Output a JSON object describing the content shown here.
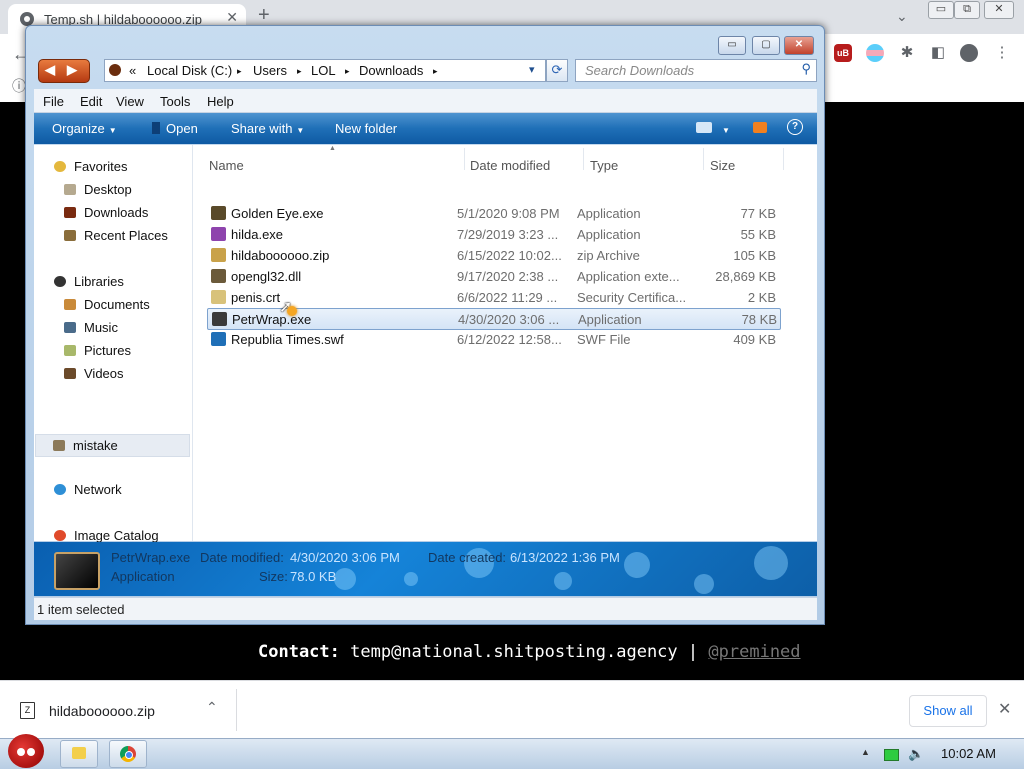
{
  "browser": {
    "tab_title": "Temp.sh | hildaboooooo.zip",
    "tab_close": "✕",
    "new_tab": "+",
    "tab_search": "⌄",
    "back_icon": "←",
    "info_icon": "ⓘ",
    "window_controls": [
      "▭",
      "⧉",
      "✕"
    ],
    "extensions": [
      "ublock-origin-icon",
      "pride-flag-icon",
      "puzzle-extensions-icon",
      "side-panel-icon",
      "profile-icon",
      "menu-dots-icon"
    ],
    "menu_dots": "⋮",
    "puzzle": "✱",
    "sidepanel": "◧",
    "ublock_text": "uB"
  },
  "explorer": {
    "title_controls": [
      "▭",
      "▢",
      "✕"
    ],
    "nav": {
      "back": "◀",
      "forward": "▶"
    },
    "address": {
      "prefix": "«",
      "segments": [
        "Local Disk (C:)",
        "Users",
        "LOL",
        "Downloads"
      ],
      "separator": "▸",
      "dropdown": "▾"
    },
    "refresh_icon": "⟳",
    "search_placeholder": "Search Downloads",
    "search_icon": "⚲",
    "menu": [
      "File",
      "Edit",
      "View",
      "Tools",
      "Help"
    ],
    "commands": {
      "organize": "Organize",
      "open": "Open",
      "share_with": "Share with",
      "new_folder": "New folder",
      "caret": "▼",
      "help": "?"
    },
    "navpane": {
      "favorites": "Favorites",
      "favorites_items": [
        "Desktop",
        "Downloads",
        "Recent Places"
      ],
      "libraries": "Libraries",
      "library_items": [
        "Documents",
        "Music",
        "Pictures",
        "Videos"
      ],
      "mistake": "mistake",
      "network": "Network",
      "image_catalog": "Image Catalog"
    },
    "columns": [
      "Name",
      "Date modified",
      "Type",
      "Size"
    ],
    "sort_arrow": "▲",
    "files": [
      {
        "name": "Golden Eye.exe",
        "date": "5/1/2020 9:08 PM",
        "type": "Application",
        "size": "77 KB",
        "icon": "exe-icon",
        "color": "#5a4a2a"
      },
      {
        "name": "hilda.exe",
        "date": "7/29/2019 3:23 ...",
        "type": "Application",
        "size": "55 KB",
        "icon": "winrar-icon",
        "color": "#8e44ad"
      },
      {
        "name": "hildaboooooo.zip",
        "date": "6/15/2022 10:02...",
        "type": "zip Archive",
        "size": "105 KB",
        "icon": "zip-icon",
        "color": "#c9a24a"
      },
      {
        "name": "opengl32.dll",
        "date": "9/17/2020 2:38 ...",
        "type": "Application exte...",
        "size": "28,869 KB",
        "icon": "dll-icon",
        "color": "#6b5a3a"
      },
      {
        "name": "penis.crt",
        "date": "6/6/2022 11:29 ...",
        "type": "Security Certifica...",
        "size": "2 KB",
        "icon": "certificate-icon",
        "color": "#d8c27a"
      },
      {
        "name": "PetrWrap.exe",
        "date": "4/30/2020 3:06 ...",
        "type": "Application",
        "size": "78 KB",
        "icon": "exe-icon",
        "color": "#3a3a3a"
      },
      {
        "name": "Republia Times.swf",
        "date": "6/12/2022 12:58...",
        "type": "SWF File",
        "size": "409 KB",
        "icon": "swf-icon",
        "color": "#1f6fb7"
      }
    ],
    "selected_index": 5,
    "details": {
      "filename": "PetrWrap.exe",
      "kind": "Application",
      "date_modified_label": "Date modified:",
      "date_modified": "4/30/2020 3:06 PM",
      "date_created_label": "Date created:",
      "date_created": "6/13/2022 1:36 PM",
      "size_label": "Size:",
      "size": "78.0 KB"
    },
    "status": "1 item selected"
  },
  "page": {
    "contact_label": "Contact:",
    "contact_email": "temp@national.shitposting.agency",
    "contact_sep": "|",
    "contact_handle": "@premined"
  },
  "downloads": {
    "file": "hildaboooooo.zip",
    "chevron": "⌃",
    "show_all": "Show all",
    "close": "✕"
  },
  "taskbar": {
    "tray_up": "▲",
    "volume": "🔈",
    "time": "10:02 AM"
  }
}
